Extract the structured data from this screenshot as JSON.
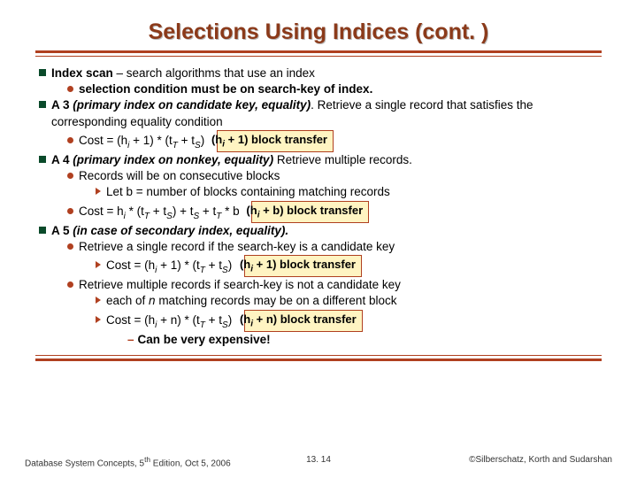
{
  "title": "Selections Using Indices (cont. )",
  "lines": {
    "b1": "Index scan",
    "b1r": " – search algorithms that use an index",
    "b1s1": "selection condition must be on search-key of index.",
    "b2a": "A 3",
    "b2b": " (primary index on candidate key, equality)",
    "b2c": ". Retrieve a single record that satisfies the corresponding equality condition",
    "b2cost_pre": "Cost = (h",
    "b2cost_i": "i",
    "b2cost_mid": " + 1) * (t",
    "b2cost_T": "T",
    "b2cost_mid2": " + t",
    "b2cost_S": "S",
    "b2cost_end": ")",
    "badge1_pre": "(h",
    "badge1_mid": " + 1)  block transfer",
    "b3a": "A 4",
    "b3b": " (primary index on nonkey, equality)",
    "b3c": " Retrieve multiple records.",
    "b3s1": "Records will be on consecutive blocks",
    "b3s2": "Let b = number of blocks containing matching records",
    "b3cost_pre": "Cost = h",
    "b3cost_mid": " * (t",
    "b3cost_mid2": " + t",
    "b3cost_mid3": ") + t",
    "b3cost_mid4": " + t",
    "b3cost_end": " * b",
    "badge2_pre": "(h",
    "badge2_mid": " + b)  block transfer",
    "b4a": "A 5",
    "b4b": " (in case of secondary index, equality).",
    "b4s1": "Retrieve a single record if the search-key is a candidate key",
    "b4cost1_pre": "Cost = (h",
    "b4cost1_mid": " + 1) * (t",
    "b4cost1_mid2": " + t",
    "b4cost1_end": ")",
    "badge3_pre": "(h",
    "badge3_mid": " + 1)  block transfer",
    "b4s2": "Retrieve multiple records if search-key is not a candidate key",
    "b4s2a_pre": "each of ",
    "b4s2a_n": "n",
    "b4s2a_post": " matching records may be on a different block",
    "b4cost2_pre": "Cost =  (h",
    "b4cost2_mid": " + n) * (t",
    "b4cost2_mid2": " + t",
    "b4cost2_end": ")",
    "badge4_pre": "(h",
    "badge4_mid": " + n)  block transfer",
    "expensive": "Can be very expensive!"
  },
  "footer": {
    "left_pre": "Database System Concepts, 5",
    "left_th": "th",
    "left_post": " Edition, Oct 5, 2006",
    "center": "13. 14",
    "right": "©Silberschatz, Korth and Sudarshan"
  }
}
